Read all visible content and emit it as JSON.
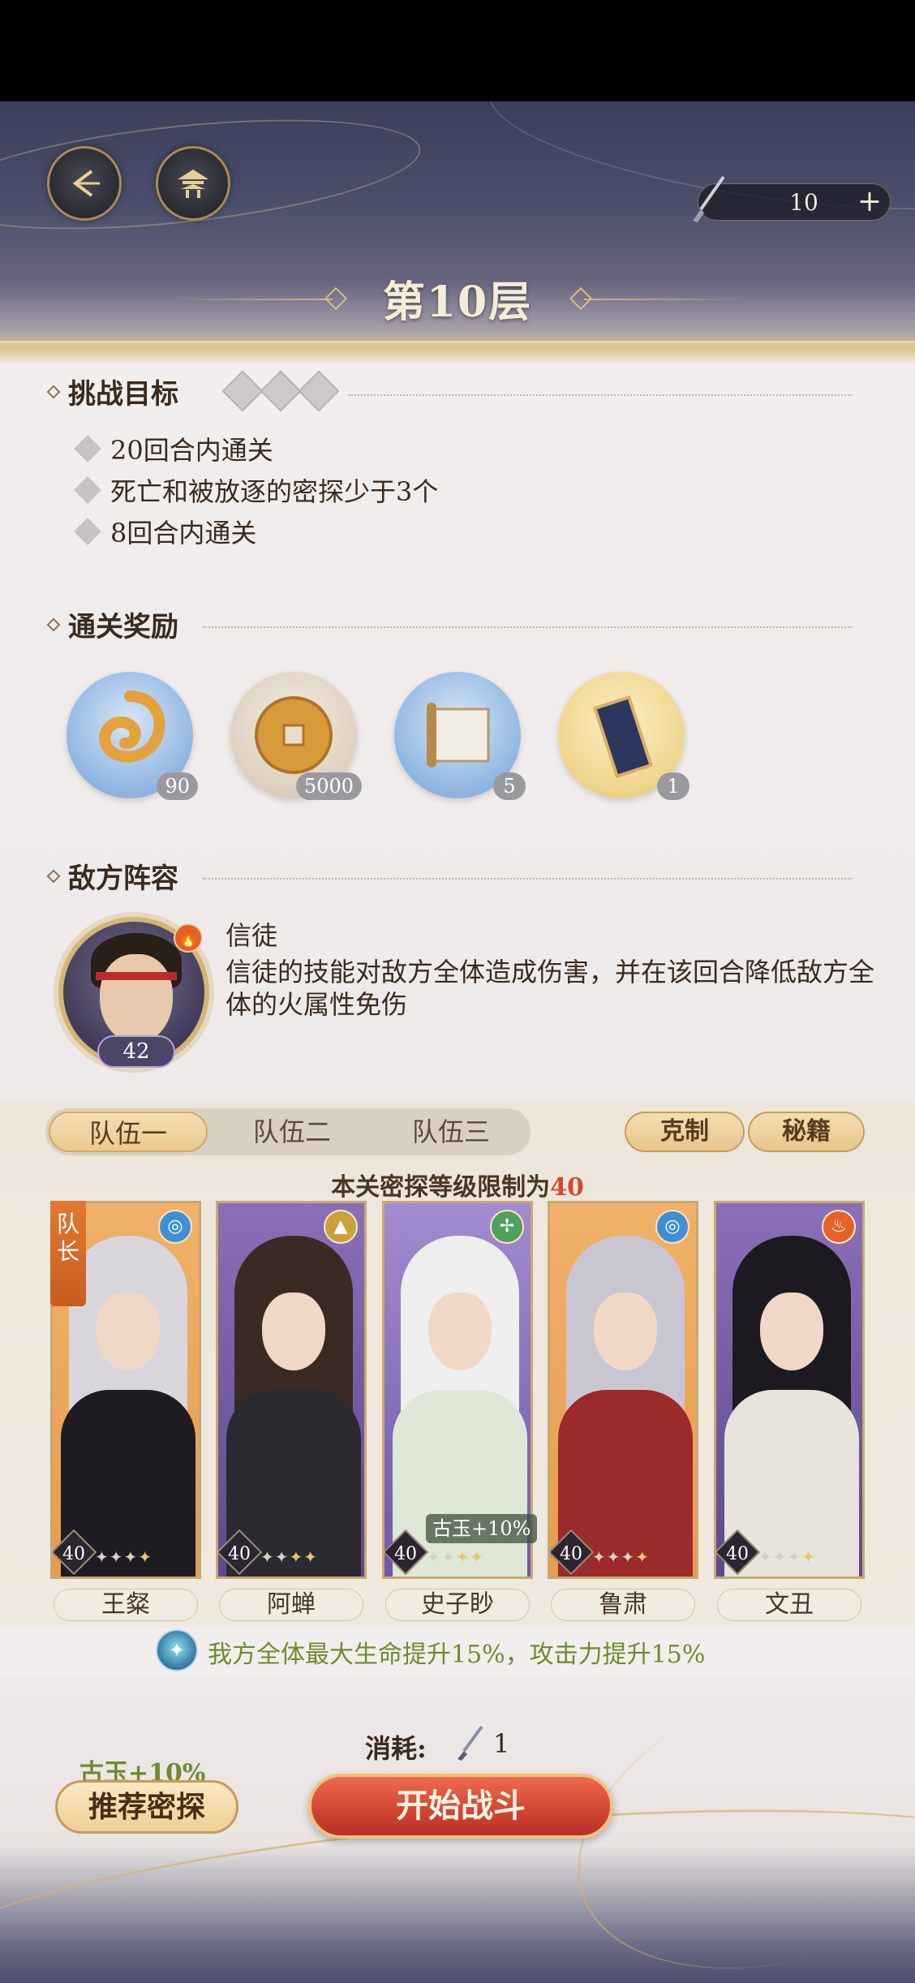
{
  "header": {
    "stamina_value": "10",
    "stamina_plus": "+",
    "floor_title": "第10层"
  },
  "objectives": {
    "heading": "挑战目标",
    "items": [
      "20回合内通关",
      "死亡和被放逐的密探少于3个",
      "8回合内通关"
    ]
  },
  "rewards": {
    "heading": "通关奖励",
    "items": [
      {
        "icon": "dragon-jade-icon",
        "count": "90"
      },
      {
        "icon": "copper-coin-icon",
        "count": "5000"
      },
      {
        "icon": "scroll-icon",
        "count": "5"
      },
      {
        "icon": "tablet-icon",
        "count": "1"
      }
    ]
  },
  "enemy": {
    "heading": "敌方阵容",
    "level": "42",
    "name": "信徒",
    "description": "信徒的技能对敌方全体造成伤害，并在该回合降低敌方全体的火属性免伤"
  },
  "team": {
    "tabs": [
      "队伍一",
      "队伍二",
      "队伍三"
    ],
    "counter_label": "克制",
    "secret_label": "秘籍",
    "level_limit_prefix": "本关密探等级限制为",
    "level_limit_value": "40",
    "leader_label": "队长",
    "card3_bonus": "古玉+10%",
    "members": [
      {
        "name": "王粲",
        "level": "40",
        "element": "water"
      },
      {
        "name": "阿蝉",
        "level": "40",
        "element": "earth"
      },
      {
        "name": "史子眇",
        "level": "40",
        "element": "wind"
      },
      {
        "name": "鲁肃",
        "level": "40",
        "element": "water"
      },
      {
        "name": "文丑",
        "level": "40",
        "element": "fire"
      }
    ],
    "buff_text": "我方全体最大生命提升15%，攻击力提升15%"
  },
  "bottom": {
    "cost_label": "消耗:",
    "cost_value": "1",
    "gu_bonus": "古玉+10%",
    "recommend_label": "推荐密探",
    "start_label": "开始战斗"
  },
  "colors": {
    "accent_gold": "#c89b5c",
    "start_red": "#d24432",
    "buff_green": "#6f8b2e",
    "limit_red": "#d24b2f"
  }
}
